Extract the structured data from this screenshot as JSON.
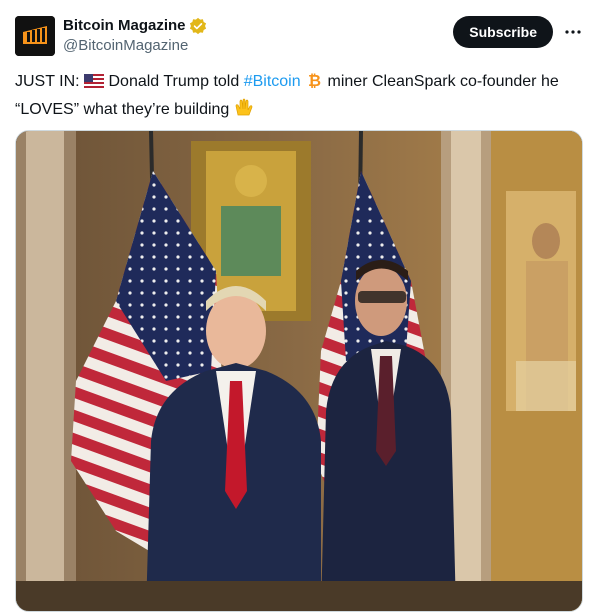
{
  "author": {
    "display_name": "Bitcoin Magazine",
    "handle": "@BitcoinMagazine",
    "verified_badge_icon": "gold-verified-badge-icon",
    "avatar_icon": "bitcoin-magazine-logo-icon"
  },
  "actions": {
    "subscribe_label": "Subscribe",
    "more_icon": "more-options-icon"
  },
  "tweet": {
    "prefix": "JUST IN: ",
    "flag_icon": "us-flag-emoji",
    "part1": " Donald Trump told ",
    "hashtag": "#Bitcoin",
    "bitcoin_icon": "bitcoin-emoji",
    "part2": " miner CleanSpark co-founder he “LOVES” what they’re building ",
    "hands_icon": "raised-hands-emoji"
  },
  "media": {
    "description_icon": "photo-two-men-with-us-flags"
  },
  "colors": {
    "link": "#1d9bf0",
    "text": "#0f1419",
    "secondary": "#536471",
    "button_bg": "#0f1419"
  }
}
